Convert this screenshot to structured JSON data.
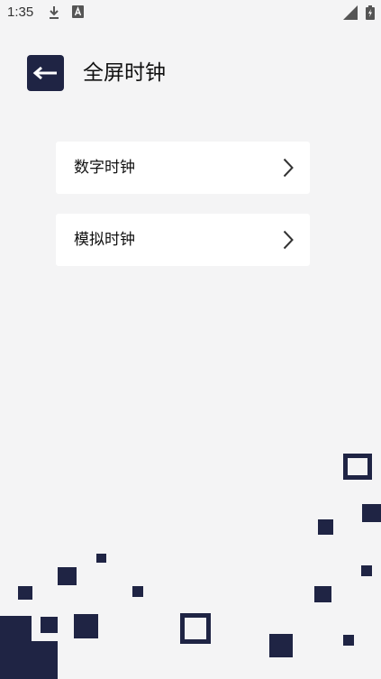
{
  "status_bar": {
    "time": "1:35",
    "icons": [
      "download-icon",
      "text-a-icon",
      "signal-icon",
      "battery-icon"
    ]
  },
  "header": {
    "title": "全屏时钟",
    "back_icon": "arrow-left-icon"
  },
  "menu": {
    "items": [
      {
        "label": "数字时钟",
        "icon": "chevron-right-icon"
      },
      {
        "label": "模拟时钟",
        "icon": "chevron-right-icon"
      }
    ]
  },
  "colors": {
    "background": "#f4f4f5",
    "accent": "#1f2444",
    "card": "#ffffff"
  }
}
